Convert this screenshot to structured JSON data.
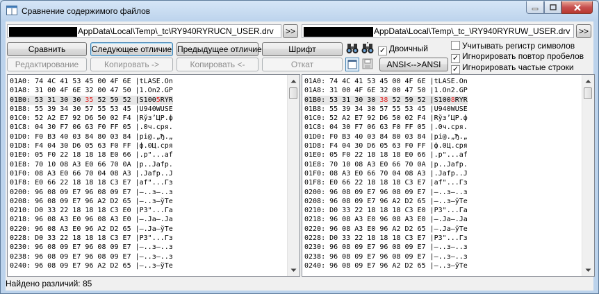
{
  "window": {
    "title": "Сравнение содержимого файлов"
  },
  "left_path": {
    "visible": "AppData\\Local\\Temp\\_tc\\RY940RYRUCN_USER.drv",
    "browse": ">>"
  },
  "right_path": {
    "visible": "AppData\\Local\\Temp\\_tc_\\RY940RYRUW_USER.drv",
    "browse": ">>"
  },
  "toolbar": {
    "compare": "Сравнить",
    "next_diff": "Следующее отличие",
    "prev_diff": "Предыдущее отличие",
    "font": "Шрифт",
    "edit": "Редактирование",
    "copy_right": "Копировать ->",
    "copy_left": "Копировать <-",
    "revert": "Откат",
    "encoding": "ANSI<-->ANSI"
  },
  "options": {
    "binary": {
      "label": "Двоичный",
      "checked": true
    },
    "case": {
      "label": "Учитывать регистр символов",
      "checked": false
    },
    "ignore_spaces": {
      "label": "Игнорировать повтор пробелов",
      "checked": true
    },
    "ignore_lines": {
      "label": "Игнорировать частые строки",
      "checked": true
    }
  },
  "left_lines": [
    "01A0: 74 4C 41 53 45 00 4F 6E |tLASE.On",
    "01A8: 31 00 4F 6E 32 00 47 50 |1.On2.GP",
    "01B0: 53 31 30 30 35 52 59 52 |S1005RYR",
    "01B8: 55 39 34 30 57 55 53 45 |U940WUSE",
    "01C0: 52 A2 E7 92 D6 50 02 F4 |Rўз’ЦР.ф",
    "01C8: 04 30 F7 06 63 F0 FF 05 |.0ч.cря.",
    "01D0: F0 B3 40 03 84 80 03 84 |рі@.„Ђ.„",
    "01D8: F4 04 30 D6 05 63 F0 FF |ф.0Ц.cря",
    "01E0: 05 F0 22 18 18 18 E0 66 |.р\"...аf",
    "01E8: 70 10 08 A3 E0 66 70 0A |p..Јаfp.",
    "01F0: 08 A3 E0 66 70 04 08 A3 |.Јаfp..Ј",
    "01F8: E0 66 22 18 18 18 C3 E7 |аf\"...Гз",
    "0200: 96 08 09 E7 96 08 09 E7 |–..з–..з",
    "0208: 96 08 09 E7 96 A2 D2 65 |–..з–ўТe",
    "0210: D0 33 22 18 18 18 C3 E0 |Р3\"...Га",
    "0218: 96 08 A3 E0 96 08 A3 E0 |–.Ја–.Ја",
    "0220: 96 08 A3 E0 96 A2 D2 65 |–.Ја–ўТe",
    "0228: D0 33 22 18 18 18 C3 E7 |Р3\"...Гз",
    "0230: 96 08 09 E7 96 08 09 E7 |–..з–..з",
    "0238: 96 08 09 E7 96 08 09 E7 |–..з–..з",
    "0240: 96 08 09 E7 96 A2 D2 65 |–..з–ўТe"
  ],
  "right_lines": [
    "01A0: 74 4C 41 53 45 00 4F 6E |tLASE.On",
    "01A8: 31 00 4F 6E 32 00 47 50 |1.On2.GP",
    "01B0: 53 31 30 30 38 52 59 52 |S1008RYR",
    "01B8: 55 39 34 30 57 55 53 45 |U940WUSE",
    "01C0: 52 A2 E7 92 D6 50 02 F4 |Rўз’ЦР.ф",
    "01C8: 04 30 F7 06 63 F0 FF 05 |.0ч.cря.",
    "01D0: F0 B3 40 03 84 80 03 84 |рі@.„Ђ.„",
    "01D8: F4 04 30 D6 05 63 F0 FF |ф.0Ц.cря",
    "01E0: 05 F0 22 18 18 18 E0 66 |.р\"...аf",
    "01E8: 70 10 08 A3 E0 66 70 0A |p..Јаfp.",
    "01F0: 08 A3 E0 66 70 04 08 A3 |.Јаfp..Ј",
    "01F8: E0 66 22 18 18 18 C3 E7 |аf\"...Гз",
    "0200: 96 08 09 E7 96 08 09 E7 |–..з–..з",
    "0208: 96 08 09 E7 96 A2 D2 65 |–..з–ўТe",
    "0210: D0 33 22 18 18 18 C3 E0 |Р3\"...Га",
    "0218: 96 08 A3 E0 96 08 A3 E0 |–.Ја–.Ја",
    "0220: 96 08 A3 E0 96 A2 D2 65 |–.Ја–ўТe",
    "0228: D0 33 22 18 18 18 C3 E7 |Р3\"...Гз",
    "0230: 96 08 09 E7 96 08 09 E7 |–..з–..з",
    "0238: 96 08 09 E7 96 08 09 E7 |–..з–..з",
    "0240: 96 08 09 E7 96 A2 D2 65 |–..з–ўТe"
  ],
  "highlight_row": 2,
  "diff_hex": {
    "left": "35",
    "right": "38"
  },
  "diff_ascii": {
    "left": "5",
    "right": "8"
  },
  "status": {
    "text": "Найдено различий: 85"
  },
  "colors": {
    "diff": "#e02020",
    "highlight": "#e6e6e6"
  },
  "icons": [
    "binoculars-icon",
    "binoculars-prev-icon",
    "view-icon",
    "save-icon",
    "scroll-up-icon",
    "scroll-down-icon"
  ]
}
